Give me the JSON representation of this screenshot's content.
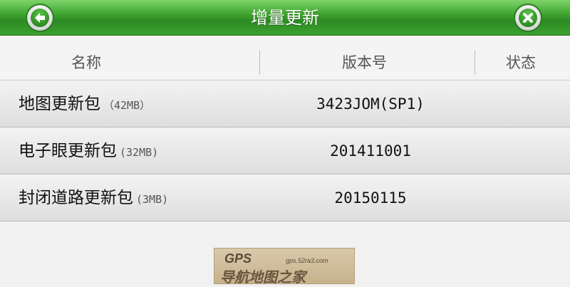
{
  "header": {
    "title": "增量更新",
    "back_icon": "arrow-left-icon",
    "close_icon": "close-icon"
  },
  "columns": [
    "名称",
    "版本号",
    "状态"
  ],
  "rows": [
    {
      "name": "地图更新包",
      "size": "（42MB）",
      "version": "3423JOM(SP1)",
      "status": ""
    },
    {
      "name": "电子眼更新包",
      "size": "(32MB)",
      "version": "201411001",
      "status": ""
    },
    {
      "name": "封闭道路更新包",
      "size": "(3MB)",
      "version": "20150115",
      "status": ""
    }
  ],
  "watermark": {
    "brand": "GPS",
    "url": "gps.52ra3.com",
    "text": "导航地图之家"
  },
  "colors": {
    "title_bar": "#3fa52f",
    "title_text": "#ffffff",
    "background": "#f1f1f1"
  }
}
